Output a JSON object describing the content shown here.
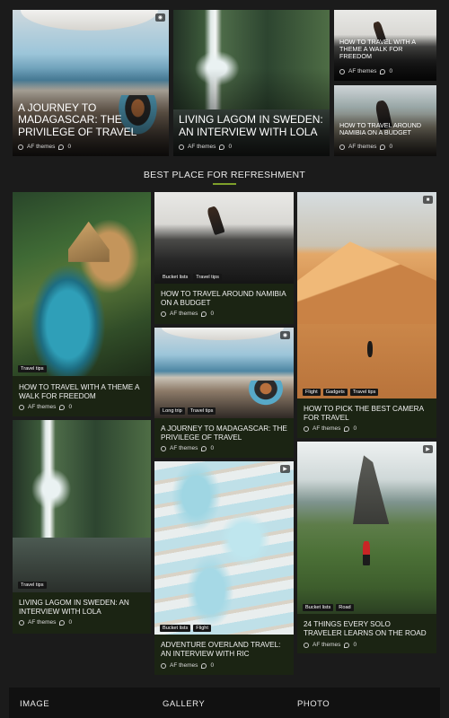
{
  "hero": [
    {
      "title": "A JOURNEY TO MADAGASCAR: THE PRIVILEGE OF TRAVEL",
      "author": "AF themes",
      "comments": "0",
      "media_icon": "camera-icon"
    },
    {
      "title": "LIVING LAGOM IN SWEDEN: AN INTERVIEW WITH LOLA",
      "author": "AF themes",
      "comments": "0"
    },
    {
      "title": "HOW TO TRAVEL WITH A THEME A WALK FOR FREEDOM",
      "author": "AF themes",
      "comments": "0"
    },
    {
      "title": "HOW TO TRAVEL AROUND NAMIBIA ON A BUDGET",
      "author": "AF themes",
      "comments": "0"
    }
  ],
  "section": {
    "heading": "BEST PLACE FOR REFRESHMENT",
    "accent": "#7ea02a"
  },
  "grid": {
    "col1": [
      {
        "tags": [
          "Travel tips"
        ],
        "title": "HOW TO TRAVEL WITH A THEME A WALK FOR FREEDOM",
        "author": "AF themes",
        "comments": "0"
      },
      {
        "tags": [
          "Travel tips"
        ],
        "title": "LIVING LAGOM IN SWEDEN: AN INTERVIEW WITH LOLA",
        "author": "AF themes",
        "comments": "0"
      }
    ],
    "col2": [
      {
        "tags": [
          "Bucket lists",
          "Travel tips"
        ],
        "title": "HOW TO TRAVEL AROUND NAMIBIA ON A BUDGET",
        "author": "AF themes",
        "comments": "0"
      },
      {
        "tags": [
          "Long trip",
          "Travel tips"
        ],
        "title": "A JOURNEY TO MADAGASCAR: THE PRIVILEGE OF TRAVEL",
        "author": "AF themes",
        "comments": "0",
        "media_icon": "camera-icon"
      },
      {
        "tags": [
          "Bucket lists",
          "Flight"
        ],
        "title": "ADVENTURE OVERLAND TRAVEL: AN INTERVIEW WITH RIC",
        "author": "AF themes",
        "comments": "0",
        "media_icon": "video-icon"
      }
    ],
    "col3": [
      {
        "tags": [
          "Flight",
          "Gadgets",
          "Travel tips"
        ],
        "title": "HOW TO PICK THE BEST CAMERA FOR TRAVEL",
        "author": "AF themes",
        "comments": "0",
        "media_icon": "chat-icon"
      },
      {
        "tags": [
          "Bucket lists",
          "Road"
        ],
        "title": "24 THINGS EVERY SOLO TRAVELER LEARNS ON THE ROAD",
        "author": "AF themes",
        "comments": "0",
        "media_icon": "video-icon"
      }
    ]
  },
  "footer": {
    "col1": "IMAGE",
    "col2": "GALLERY",
    "col3": "PHOTO"
  }
}
